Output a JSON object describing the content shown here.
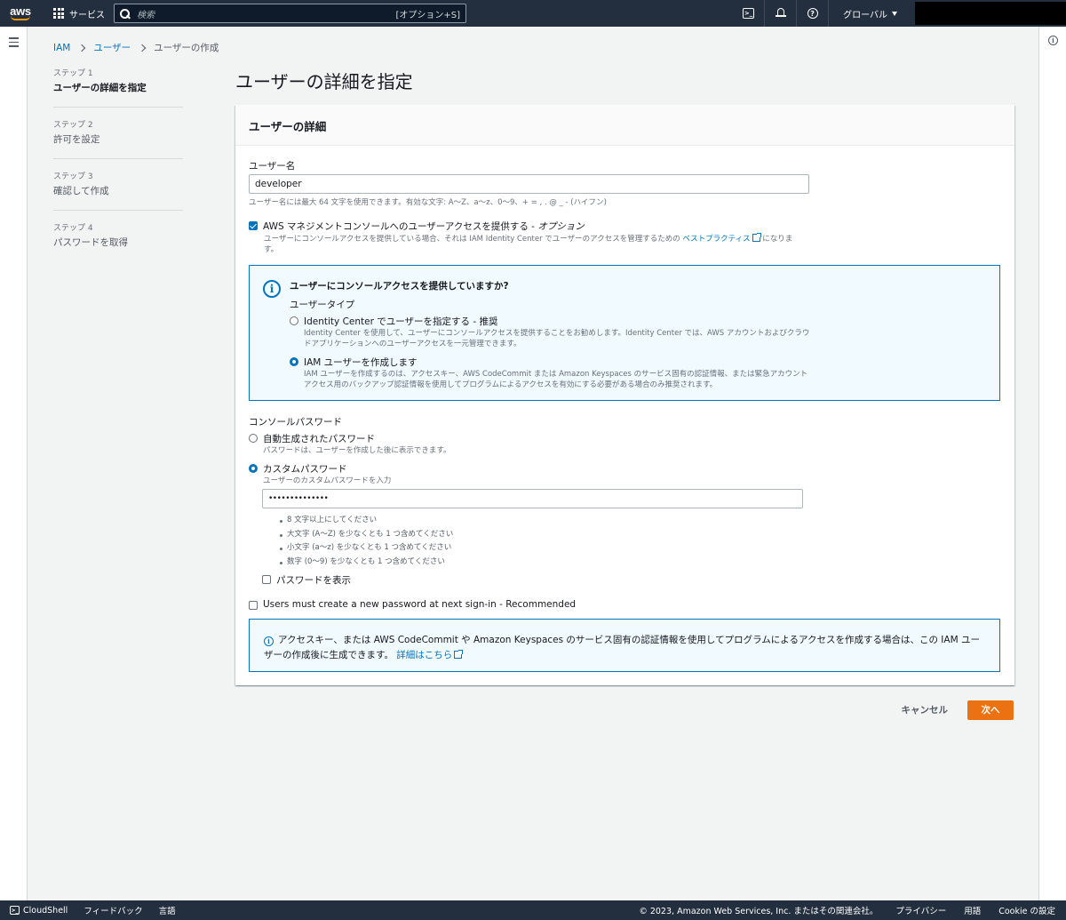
{
  "nav": {
    "logo": "aws",
    "services_label": "サービス",
    "search_placeholder": "検索",
    "search_shortcut": "[オプション+S]",
    "region": "グローバル"
  },
  "breadcrumb": [
    "IAM",
    "ユーザー",
    "ユーザーの作成"
  ],
  "steps": [
    {
      "num": "ステップ 1",
      "label": "ユーザーの詳細を指定",
      "active": true
    },
    {
      "num": "ステップ 2",
      "label": "許可を設定"
    },
    {
      "num": "ステップ 3",
      "label": "確認して作成"
    },
    {
      "num": "ステップ 4",
      "label": "パスワードを取得"
    }
  ],
  "page_title": "ユーザーの詳細を指定",
  "panel": {
    "heading": "ユーザーの詳細",
    "username_label": "ユーザー名",
    "username_value": "developer",
    "username_hint": "ユーザー名には最大 64 文字を使用できます。有効な文字: A〜Z、a〜z、0〜9、+ = , . @ _ - (ハイフン)",
    "console_access_label": "AWS マネジメントコンソールへのユーザーアクセスを提供する - ",
    "console_access_optional": "オプション",
    "console_access_hint_pre": "ユーザーにコンソールアクセスを提供している場合、それは IAM Identity Center でユーザーのアクセスを管理するための",
    "console_access_hint_link": "ベストプラクティス",
    "console_access_hint_post": "になります。",
    "infobox": {
      "title": "ユーザーにコンソールアクセスを提供していますか?",
      "user_type_label": "ユーザータイプ",
      "opt1_label": "Identity Center でユーザーを指定する - 推奨",
      "opt1_desc": "Identity Center を使用して、ユーザーにコンソールアクセスを提供することをお勧めします。Identity Center では、AWS アカウントおよびクラウドアプリケーションへのユーザーアクセスを一元管理できます。",
      "opt2_label": "IAM ユーザーを作成します",
      "opt2_desc": "IAM ユーザーを作成するのは、アクセスキー、AWS CodeCommit または Amazon Keyspaces のサービス固有の認証情報、または緊急アカウントアクセス用のバックアップ認証情報を使用してプログラムによるアクセスを有効にする必要がある場合のみ推奨されます。"
    },
    "password_label": "コンソールパスワード",
    "pw_auto_label": "自動生成されたパスワード",
    "pw_auto_hint": "パスワードは、ユーザーを作成した後に表示できます。",
    "pw_custom_label": "カスタムパスワード",
    "pw_custom_hint": "ユーザーのカスタムパスワードを入力",
    "pw_value": "••••••••••••••",
    "pw_rules": [
      "8 文字以上にしてください",
      "大文字 (A〜Z) を少なくとも 1 つ含めてください",
      "小文字 (a〜z) を少なくとも 1 つ含めてください",
      "数字 (0〜9) を少なくとも 1 つ含めてください"
    ],
    "show_password_label": "パスワードを表示",
    "must_reset_label": "Users must create a new password at next sign-in - Recommended",
    "bottom_info_text": "アクセスキー、または AWS CodeCommit や Amazon Keyspaces のサービス固有の認証情報を使用してプログラムによるアクセスを作成する場合は、この IAM ユーザーの作成後に生成できます。",
    "bottom_info_link": "詳細はこちら"
  },
  "actions": {
    "cancel": "キャンセル",
    "next": "次へ"
  },
  "footer": {
    "cloudshell": "CloudShell",
    "feedback": "フィードバック",
    "language": "言語",
    "copyright": "© 2023, Amazon Web Services, Inc. またはその関連会社。",
    "privacy": "プライバシー",
    "terms": "用語",
    "cookie": "Cookie の設定"
  },
  "colors": {
    "nav_bg": "#232f3e",
    "link": "#0073bb",
    "primary_button": "#ec7211",
    "info_bg": "#f1faff"
  }
}
